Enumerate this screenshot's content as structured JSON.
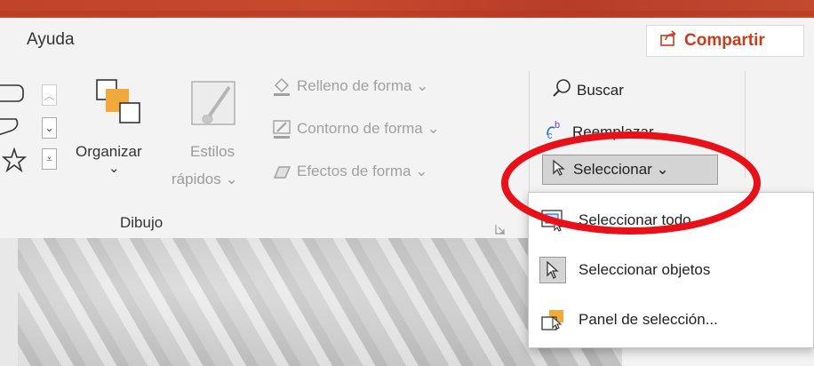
{
  "tabs": {
    "help": "Ayuda"
  },
  "share": {
    "label": "Compartir"
  },
  "ribbon": {
    "arrange": {
      "label": "Organizar",
      "chevron": "⌄"
    },
    "quick_styles": {
      "line1": "Estilos",
      "line2": "rápidos ⌄"
    },
    "shape_fill": "Relleno de forma ⌄",
    "shape_outline": "Contorno de forma ⌄",
    "shape_effects": "Efectos de forma ⌄",
    "group_label": "Dibujo"
  },
  "editing": {
    "find": "Buscar",
    "replace": "Reemplazar ⌄",
    "select": "Seleccionar ⌄"
  },
  "select_menu": {
    "items": [
      {
        "label": "Seleccionar todo",
        "icon": "select-all-icon"
      },
      {
        "label": "Seleccionar objetos",
        "icon": "select-objects-icon"
      },
      {
        "label": "Panel de selección...",
        "icon": "selection-pane-icon"
      }
    ]
  },
  "colors": {
    "accent": "#c43e1c",
    "highlight": "#e8111a",
    "orange_icon": "#f2a93b"
  }
}
